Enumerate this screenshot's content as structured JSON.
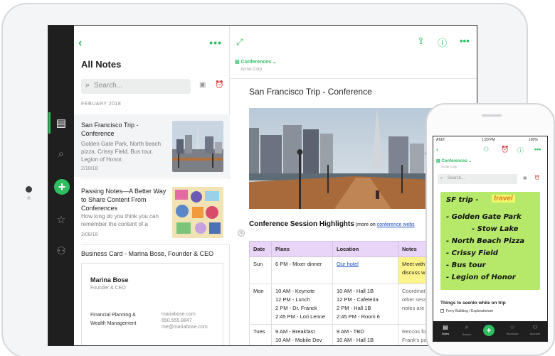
{
  "app": {
    "accent": "#2dbe60",
    "rail": {
      "items": [
        {
          "name": "notes-icon",
          "glyph": "▤"
        },
        {
          "name": "search-icon",
          "glyph": "⌕"
        },
        {
          "name": "add-note-icon",
          "glyph": "+"
        },
        {
          "name": "shortcuts-star-icon",
          "glyph": "☆"
        },
        {
          "name": "account-icon",
          "glyph": "⚇"
        }
      ]
    },
    "list": {
      "back_glyph": "‹",
      "more_glyph": "•••",
      "title": "All Notes",
      "search_placeholder": "Search...",
      "month": "FEBUARY 2018",
      "notes": [
        {
          "title": "San Francisco Trip - Conference",
          "snippet": "Golden Gate Park, North beach pizza, Crissy Field, Bus tour, Legion of Honor.",
          "date": "2/10/18"
        },
        {
          "title": "Passing Notes—A Better Way to Share Content From Conferences",
          "snippet": "How long do you think you can remember the content of a",
          "date": "2/08/18"
        }
      ],
      "business_card": {
        "title": "Business Card - Marina Bose, Founder & CEO",
        "name": "Marina Bose",
        "role": "Founder & CEO",
        "company_line1": "Financial Planning &",
        "company_line2": "Wealth Management",
        "web": "mariabose.com",
        "phone": "650.555.8847",
        "email": "me@mariabose.com"
      }
    },
    "editor": {
      "notebook": "Conferences ⌄",
      "org": "Acme Corp",
      "title": "San Francisco Trip - Conference",
      "heading": "Conference Session Highlights",
      "heading_more_prefix": " (more on ",
      "heading_link": "conference webs",
      "table": {
        "headers": [
          "Date",
          "Plans",
          "Location",
          "Notes"
        ],
        "rows": [
          {
            "date": "Sun",
            "plans": [
              "6 PM - Mixer dinner"
            ],
            "location": [
              "Our hotel"
            ],
            "notes": [
              "Meet with",
              "discuss w"
            ]
          },
          {
            "date": "Mon",
            "plans": [
              "10 AM - Keynote",
              "12 PM - Lunch",
              "2 PM - Dr. Franck",
              "2:45 PM - Lori Lenne"
            ],
            "location": [
              "10 AM - Hall 1B",
              "12 PM - Cafeteria",
              "2 PM - Hall 1B",
              "2:45 PM - Room 6"
            ],
            "notes": [
              "Coordinat",
              "other sess",
              "notes are"
            ]
          },
          {
            "date": "Tues",
            "plans": [
              "9 AM - Breakfast",
              "10 AM - Mobile Dev"
            ],
            "location": [
              "9 AM - TBD",
              "10 AM - Hall 1B"
            ],
            "notes": [
              "Reccos for",
              "Frank's pa"
            ]
          }
        ]
      }
    },
    "phone": {
      "carrier": "AT&T",
      "time": "1:20 PM",
      "battery": "100%",
      "notebook": "Conferences ⌄",
      "org": "Acme Corp",
      "search_placeholder": "Search...",
      "sticky_title": "SF trip -",
      "sticky_tag": "travel",
      "sticky_lines": [
        "- Golden Gate Park",
        "- Stow Lake",
        "- North Beach Pizza",
        "- Crissy Field",
        "- Bus tour",
        "- Legion of Honor"
      ],
      "things_heading": "Things to see/do while on trip",
      "things_item": "Ferry Building / Exploratorium",
      "tabs": [
        "Notes",
        "Search",
        "Shortcuts",
        "Account"
      ]
    }
  }
}
